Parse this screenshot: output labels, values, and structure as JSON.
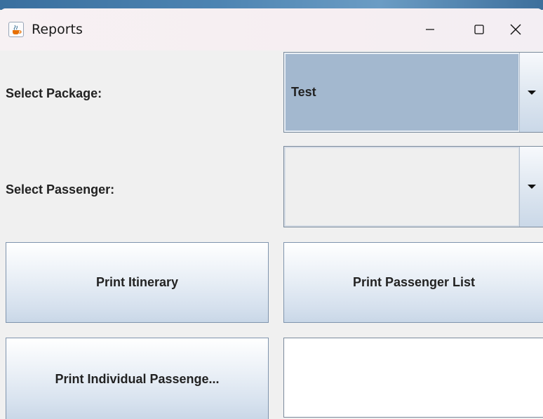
{
  "window": {
    "title": "Reports",
    "icon": "java-cup-icon",
    "controls": [
      "minimize-icon",
      "maximize-icon",
      "close-icon"
    ]
  },
  "form": {
    "package_label": "Select Package:",
    "package_value": "Test",
    "passenger_label": "Select Passenger:",
    "passenger_value": ""
  },
  "buttons": {
    "print_itinerary": "Print Itinerary",
    "print_passenger_list": "Print Passenger List",
    "print_individual": "Print Individual Passenge..."
  },
  "output": {
    "text": ""
  },
  "colors": {
    "selected_field": "#a3b8cf",
    "background": "#f0f0f0"
  }
}
